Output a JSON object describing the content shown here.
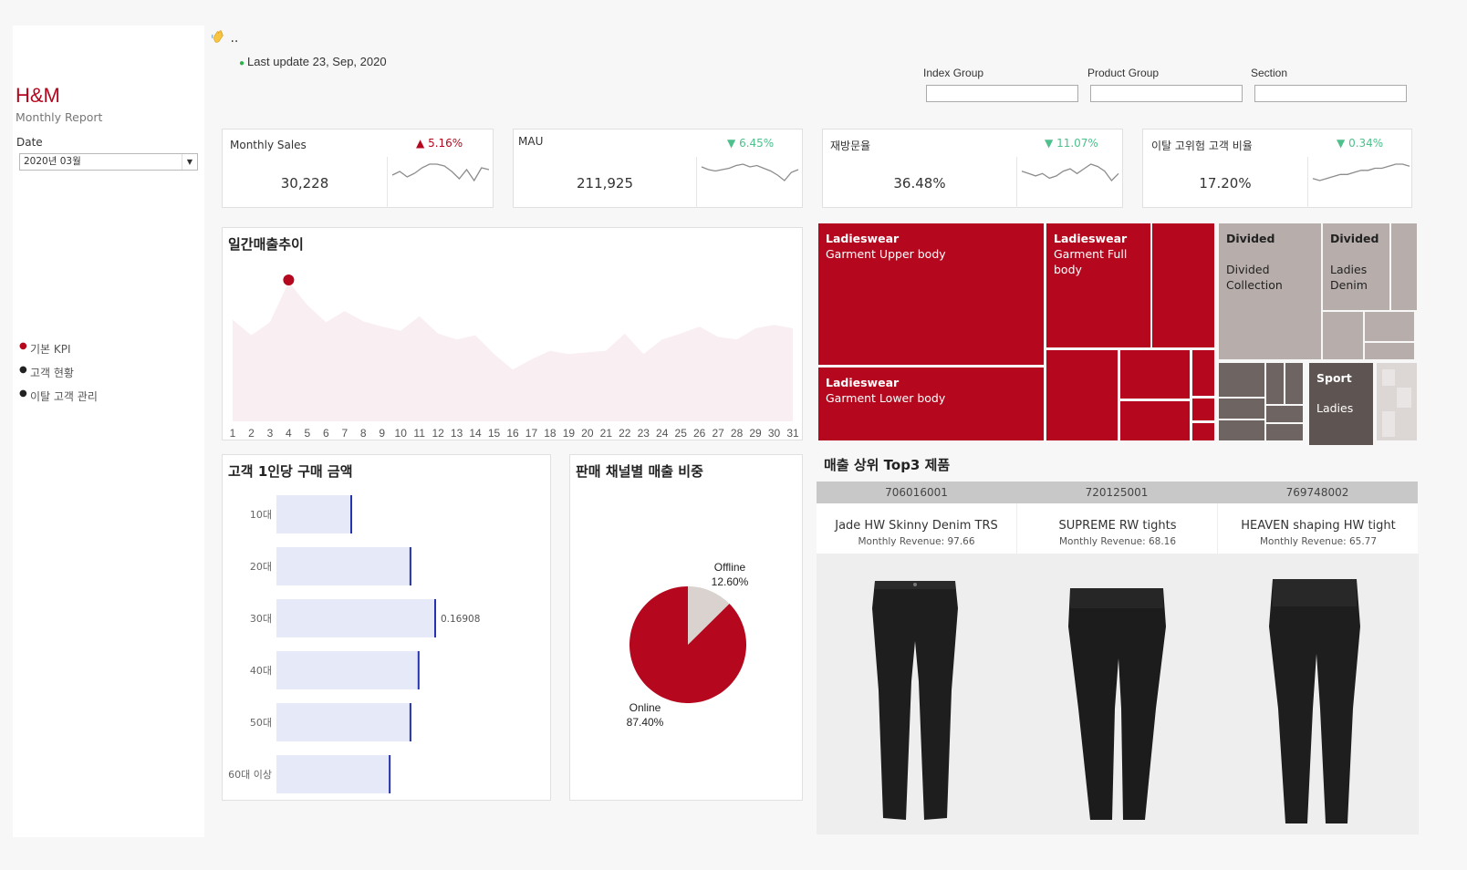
{
  "sidebar": {
    "brand": "H&M",
    "subtitle": "Monthly Report",
    "date_label": "Date",
    "date_value": "2020년 03월",
    "nav": [
      {
        "label": "기본 KPI",
        "active": true
      },
      {
        "label": "고객 현황",
        "active": false
      },
      {
        "label": "이탈 고객 관리",
        "active": false
      }
    ]
  },
  "header": {
    "greeting_icon": "waving-hand-icon",
    "greeting": "..",
    "last_update": "Last update 23, Sep, 2020"
  },
  "filters": [
    {
      "label": "Index Group",
      "value": ""
    },
    {
      "label": "Product Group",
      "value": ""
    },
    {
      "label": "Section",
      "value": ""
    }
  ],
  "kpis": [
    {
      "title": "Monthly Sales",
      "value": "30,228",
      "change": "5.16%",
      "direction": "up",
      "spark": [
        26,
        28,
        25,
        27,
        30,
        32,
        32,
        31,
        28,
        24,
        29,
        23,
        30,
        29
      ]
    },
    {
      "title": "MAU",
      "value": "211,925",
      "change": "6.45%",
      "direction": "down",
      "spark": [
        30,
        28,
        27,
        28,
        29,
        31,
        32,
        30,
        31,
        29,
        27,
        24,
        20,
        26,
        28
      ]
    },
    {
      "title": "재방문율",
      "value": "36.48%",
      "change": "11.07%",
      "direction": "down",
      "spark": [
        30,
        29,
        28,
        29,
        27,
        28,
        30,
        31,
        29,
        31,
        33,
        32,
        30,
        26,
        29
      ]
    },
    {
      "title": "이탈 고위험 고객 비율",
      "value": "17.20%",
      "change": "0.34%",
      "direction": "down",
      "spark": [
        26,
        25,
        26,
        27,
        28,
        28,
        29,
        30,
        30,
        31,
        31,
        32,
        33,
        33,
        32
      ]
    }
  ],
  "daily_sales": {
    "title": "일간매출추이",
    "chart_data": {
      "type": "area",
      "x": [
        1,
        2,
        3,
        4,
        5,
        6,
        7,
        8,
        9,
        10,
        11,
        12,
        13,
        14,
        15,
        16,
        17,
        18,
        19,
        20,
        21,
        22,
        23,
        24,
        25,
        26,
        27,
        28,
        29,
        30,
        31
      ],
      "values": [
        118,
        100,
        115,
        162,
        135,
        115,
        128,
        116,
        110,
        105,
        122,
        102,
        95,
        100,
        78,
        60,
        72,
        82,
        78,
        80,
        82,
        102,
        78,
        95,
        102,
        110,
        98,
        95,
        108,
        112,
        108
      ],
      "highlight_index": 3,
      "fill": "#f9eef1",
      "marker_color": "#b5081e"
    }
  },
  "age_spend": {
    "title": "고객 1인당 구매 금액",
    "chart_data": {
      "type": "bar",
      "categories": [
        "10대",
        "20대",
        "30대",
        "40대",
        "50대",
        "60대 이상"
      ],
      "values": [
        0.0802,
        0.1429,
        0.16908,
        0.1515,
        0.1429,
        0.1209
      ],
      "value_label": "0.16908",
      "value_label_index": 2,
      "bar_color": "#e6e9f8",
      "line_color": "#2633b0"
    }
  },
  "channel_share": {
    "title": "판매 채널별 매출 비중",
    "chart_data": {
      "type": "pie",
      "categories": [
        "Online",
        "Offline"
      ],
      "values": [
        87.4,
        12.6
      ],
      "labels": [
        "87.40%",
        "12.60%"
      ],
      "colors": [
        "#b5081e",
        "#d9d2cf"
      ]
    }
  },
  "treemap": {
    "tiles": [
      {
        "l1": "Ladieswear",
        "l2": "Garment Upper body",
        "color": "#b5081e",
        "dark": false
      },
      {
        "l1": "Ladieswear",
        "l2": "Garment Full body",
        "color": "#b5081e",
        "dark": false
      },
      {
        "l1": "Ladieswear",
        "l2": "Garment Lower body",
        "color": "#b5081e",
        "dark": false
      },
      {
        "l1": "Divided",
        "l2": "Divided Collection",
        "color": "#b7aeab",
        "dark": true
      },
      {
        "l1": "Divided",
        "l2": "Ladies Denim",
        "color": "#b7aeab",
        "dark": true
      },
      {
        "l1": "Sport",
        "l2": "Ladies",
        "color": "#5e5452",
        "dark": false
      }
    ],
    "colors": {
      "red": "#b5081e",
      "grey": "#b7aeab",
      "dark": "#6e6563",
      "light": "#dcd6d4"
    }
  },
  "top3": {
    "title": "매출 상위 Top3 제품",
    "revenue_label": "Monthly Revenue:",
    "items": [
      {
        "id": "706016001",
        "name": "Jade HW Skinny Denim TRS",
        "revenue": "97.66",
        "image": "pants-icon"
      },
      {
        "id": "720125001",
        "name": "SUPREME RW tights",
        "revenue": "68.16",
        "image": "tights-icon"
      },
      {
        "id": "769748002",
        "name": "HEAVEN shaping HW tight",
        "revenue": "65.77",
        "image": "tights-icon"
      }
    ]
  }
}
